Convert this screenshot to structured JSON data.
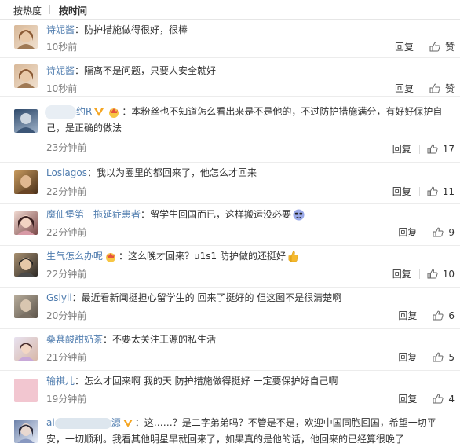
{
  "sort": {
    "hot": "按热度",
    "time": "按时间"
  },
  "comments": [
    {
      "user": "诗妮酱",
      "text": "：防护措施做得很好，很棒",
      "time": "10秒前",
      "reply": "回复",
      "like": "赞",
      "avatar_colors": [
        "#c9a88a",
        "#e9d6c4"
      ]
    },
    {
      "user": "诗妮酱",
      "text": "：隔离不是问题，只要人安全就好",
      "time": "10秒前",
      "reply": "回复",
      "like": "赞",
      "avatar_colors": [
        "#c9a88a",
        "#e9d6c4"
      ]
    },
    {
      "user": "约R",
      "text": "：本粉丝也不知道怎么看出来是不是他的，不过防护措施满分，有好好保护自己，是正确的做法",
      "time": "23分钟前",
      "reply": "回复",
      "like": "17",
      "avatar_colors": [
        "#5f7a99",
        "#d9dfe6"
      ]
    },
    {
      "user": "Loslagos",
      "text": "：我以为圈里的都回来了，他怎么才回来",
      "time": "22分钟前",
      "reply": "回复",
      "like": "11",
      "avatar_colors": [
        "#b58a5a",
        "#5a3b22"
      ]
    },
    {
      "user": "魔仙堡第一拖延症患者",
      "text": "：留学生回国而已，这样搬运没必要",
      "time": "22分钟前",
      "reply": "回复",
      "like": "9",
      "avatar_colors": [
        "#e8c7c0",
        "#6b3b3b"
      ]
    },
    {
      "user": "生气怎么办呢",
      "text": "：这么晚才回来？u1s1 防护做的还挺好",
      "time": "22分钟前",
      "reply": "回复",
      "like": "10",
      "avatar_colors": [
        "#a08060",
        "#3a3a3a"
      ]
    },
    {
      "user": "Gsiyii",
      "text": "：最近看新闻挺担心留学生的 回来了挺好的 但这图不是很清楚啊",
      "time": "20分钟前",
      "reply": "回复",
      "like": "6",
      "avatar_colors": [
        "#9a8f80",
        "#d4ccc0"
      ]
    },
    {
      "user": "桑葚酸甜奶茶",
      "text": "：不要太关注王源的私生活",
      "time": "21分钟前",
      "reply": "回复",
      "like": "5",
      "avatar_colors": [
        "#d9d4e6",
        "#e9c9b8"
      ]
    },
    {
      "user": "输祺儿",
      "text": "：怎么才回来啊 我的天 防护措施做得挺好 一定要保护好自己啊",
      "time": "19分钟前",
      "reply": "回复",
      "like": "4",
      "avatar_colors": [
        "#f2c6d0",
        "#f2c6d0"
      ]
    },
    {
      "user_prefix": "ai",
      "user_suffix": "源",
      "text": "：这……？是二字弟弟吗？不管是不是，欢迎中国同胞回国，希望一切平安，一切顺利。我看其他明星早就回来了，如果真的是他的话，他回来的已经算很晚了",
      "avatar_colors": [
        "#8fa0c0",
        "#dfe6f2"
      ]
    }
  ],
  "colors": {
    "accent": "#eb7350",
    "link": "#507daf",
    "muted": "#808080"
  }
}
